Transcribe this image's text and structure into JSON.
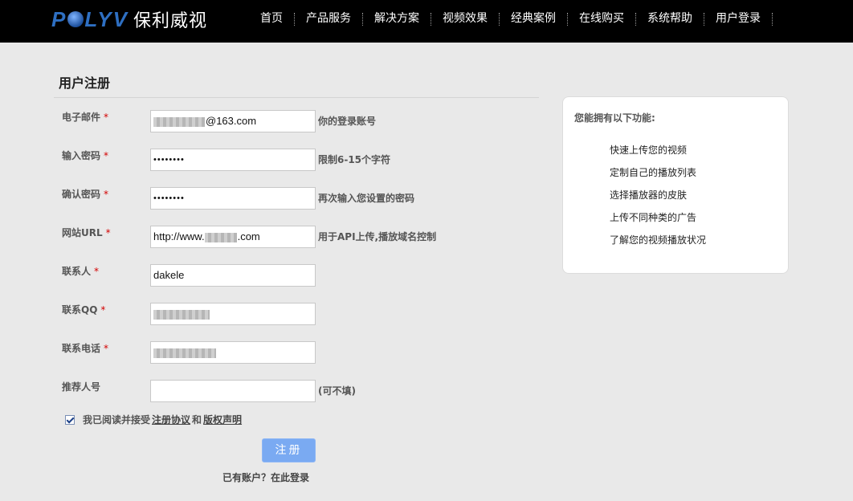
{
  "header": {
    "logo_text": "POLYV",
    "logo_cn": "保利威视",
    "nav": [
      "首页",
      "产品服务",
      "解决方案",
      "视频效果",
      "经典案例",
      "在线购买",
      "系统帮助",
      "用户登录"
    ]
  },
  "form": {
    "title": "用户注册",
    "fields": [
      {
        "label": "电子邮件",
        "required": "*",
        "value": "@163.com",
        "hint": "你的登录账号"
      },
      {
        "label": "输入密码",
        "required": "*",
        "value": "••••••••",
        "hint": "限制6-15个字符"
      },
      {
        "label": "确认密码",
        "required": "*",
        "value": "••••••••",
        "hint": "再次输入您设置的密码"
      },
      {
        "label": "网站URL",
        "required": "*",
        "value_prefix": "http://www.",
        "value_suffix": ".com",
        "hint": "用于API上传,播放域名控制"
      },
      {
        "label": "联系人",
        "required": "*",
        "value": "dakele",
        "hint": ""
      },
      {
        "label": "联系QQ",
        "required": "*",
        "value": "",
        "hint": ""
      },
      {
        "label": "联系电话",
        "required": "*",
        "value": "",
        "hint": ""
      },
      {
        "label": "推荐人号",
        "required": "",
        "value": "",
        "hint": "(可不填)"
      }
    ],
    "agree_text": "我已阅读并接受",
    "agree_link1": "注册协议",
    "agree_and": "和",
    "agree_link2": "版权声明",
    "agree_checked": true,
    "submit_label": "注册",
    "login_link": "已有账户？在此登录"
  },
  "panel": {
    "title": "您能拥有以下功能:",
    "items": [
      "快速上传您的视频",
      "定制自己的播放列表",
      "选择播放器的皮肤",
      "上传不同种类的广告",
      "了解您的视频播放状况"
    ]
  }
}
